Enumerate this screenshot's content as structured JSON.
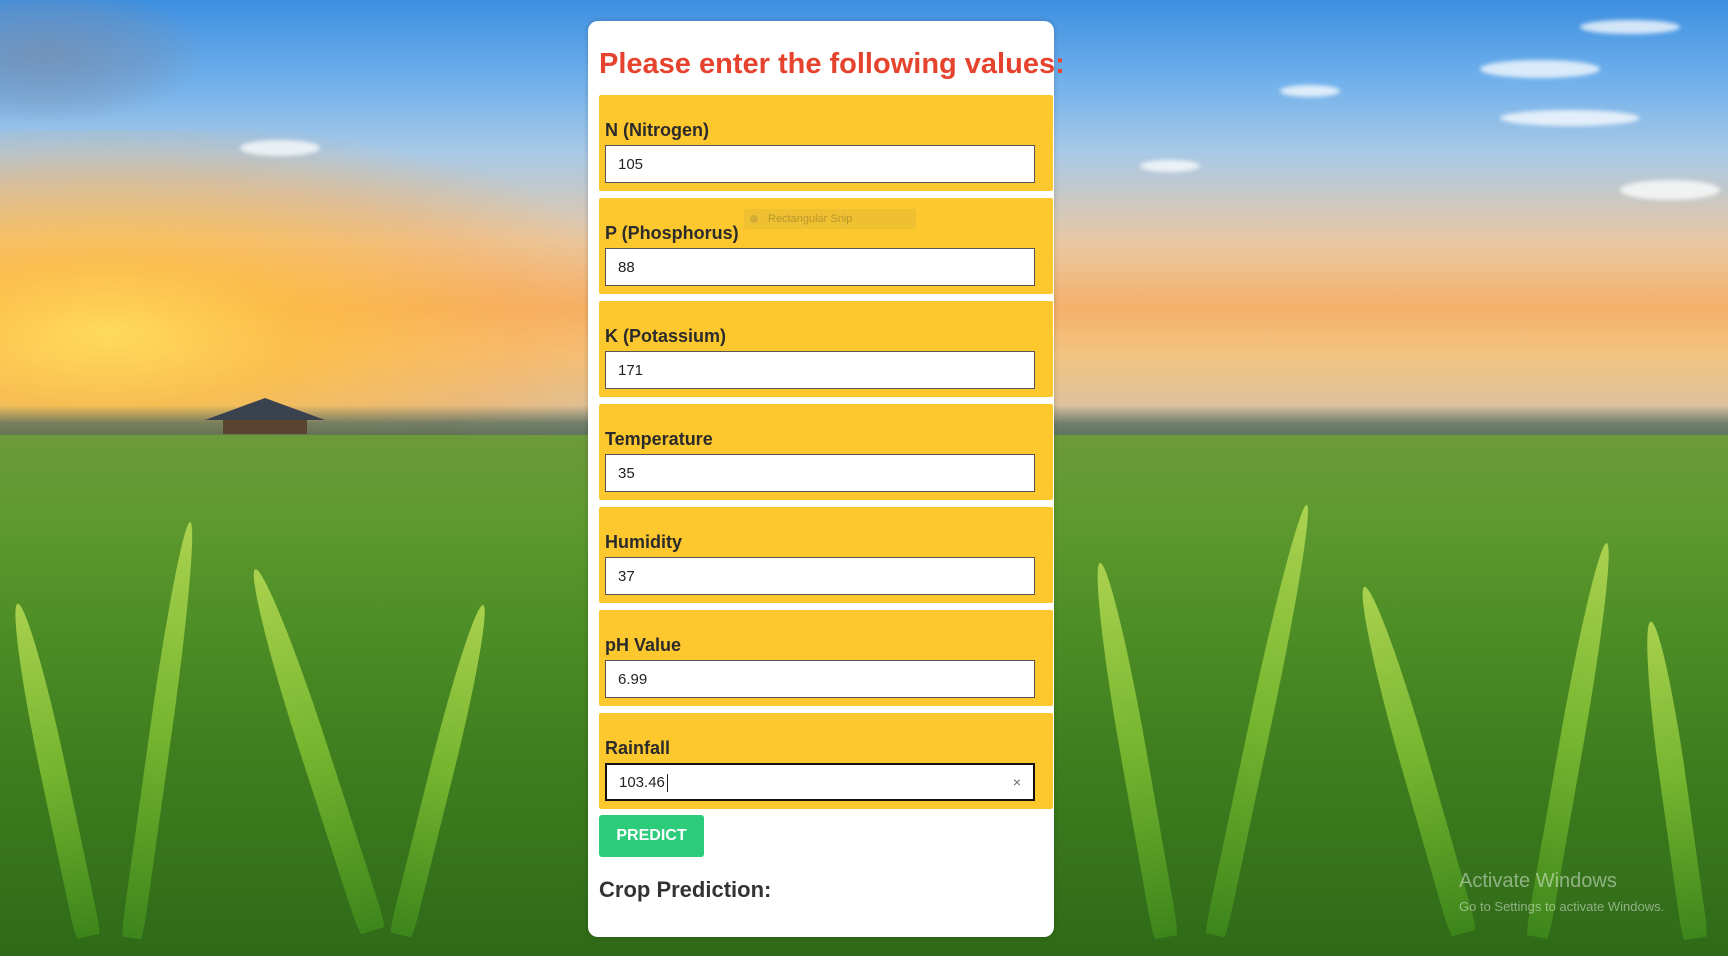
{
  "form": {
    "heading": "Please enter the following values:",
    "fields": [
      {
        "label": "N (Nitrogen)",
        "value": "105"
      },
      {
        "label": "P (Phosphorus)",
        "value": "88"
      },
      {
        "label": "K (Potassium)",
        "value": "171"
      },
      {
        "label": "Temperature",
        "value": "35"
      },
      {
        "label": "Humidity",
        "value": "37"
      },
      {
        "label": "pH Value",
        "value": "6.99"
      },
      {
        "label": "Rainfall",
        "value": "103.46"
      }
    ],
    "clear_glyph": "×",
    "predict_label": "PREDICT",
    "result_heading": "Crop Prediction:"
  },
  "snip_overlay": {
    "label": "Rectangular Snip"
  },
  "watermark": {
    "line1": "Activate Windows",
    "line2": "Go to Settings to activate Windows."
  },
  "colors": {
    "heading": "#e6432e",
    "field_group_bg": "#fdc72e",
    "predict_button": "#2dcc7a"
  }
}
